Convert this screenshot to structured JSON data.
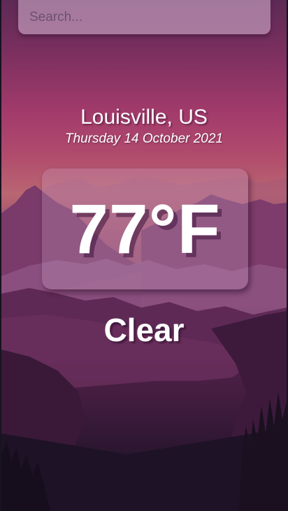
{
  "search": {
    "placeholder": "Search...",
    "value": ""
  },
  "location": {
    "city": "Louisville, US",
    "date": "Thursday 14 October 2021"
  },
  "current": {
    "temperature": "77°F",
    "condition": "Clear"
  },
  "colors": {
    "sky_top": "#5d2a55",
    "sky_mid": "#a23b6b",
    "horizon": "#b96672",
    "foreground": "#14101d",
    "text": "#ffffff"
  }
}
